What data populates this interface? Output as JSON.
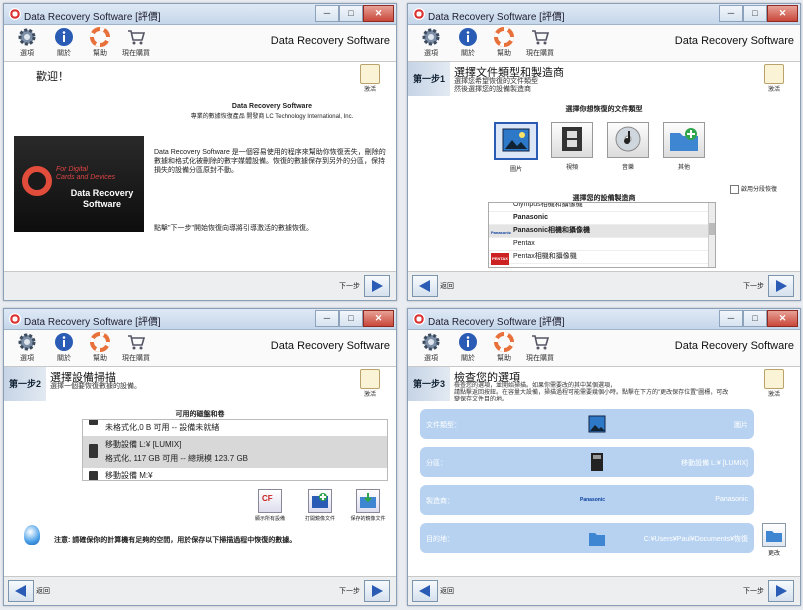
{
  "app": {
    "window_title": "Data Recovery Software [評價]",
    "brand": "Data Recovery Software",
    "toolbar": [
      "選項",
      "關於",
      "幫助",
      "現在購買"
    ],
    "key_label": "激活",
    "next_label": "下一步",
    "back_label": "返回",
    "win_controls": {
      "min": "─",
      "max": "□",
      "close": "✕"
    }
  },
  "colors": {
    "accent": "#2a5bb5",
    "summary_row": "#b7d2f0",
    "logo_red": "#e24c3b"
  },
  "icons": {
    "options": "gear-icon",
    "about": "info-icon",
    "help": "lifebuoy-icon",
    "buy": "cart-icon",
    "activate": "key-icon",
    "next": "arrow-right-icon",
    "back": "arrow-left-icon"
  },
  "w1": {
    "title": "歡迎！",
    "product": "Data Recovery Software",
    "company": "專業的數據恢復產品 開發商 LC Technology International, Inc.",
    "desc": "Data Recovery Software 是一個容易使用的程序來幫助你恢復丟失，刪除的數據和格式化被刪除的數字媒體設備。恢復的數據保存到另外的分區，保持損失的設備分區原封不動。",
    "hint": "點擊\"下一步\"開始恢復向導將引導激活的數據恢復。",
    "logo_red": "For Digital\nCards and Devices",
    "logo_white": "Data Recovery Software"
  },
  "w2": {
    "step": "第一步1",
    "title": "選擇文件類型和製造商",
    "sub": "選擇您希望恢復的文件類型\n然後選擇您的設備製造商",
    "file_types_header": "選擇你想恢復的文件類型",
    "file_types": [
      "圖片",
      "視頻",
      "音樂",
      "其他"
    ],
    "advanced_label": "啟用分段恢復",
    "mfr_header": "選擇您的設備製造商",
    "mfr_rows": [
      "Olympus相機和攝像機",
      "Panasonic",
      "Panasonic相機和攝像機",
      "Pentax",
      "Pentax相機和攝像機"
    ],
    "mfr_logo_panasonic": "Panasonic",
    "mfr_logo_pentax": "PENTAX"
  },
  "w3": {
    "step": "第一步2",
    "title": "選擇設備掃描",
    "sub": "選擇一個要恢復數據的設備。",
    "drives_header": "可用的磁盤和卷",
    "drives": [
      "未格式化,0 B 可用 -- 設備未就緒",
      "移動設備 L:¥ [LUMIX]",
      "格式化, 117 GB 可用 -- 總規模  123.7 GB",
      "移動設備 M:¥"
    ],
    "actions": [
      "顯示所有設備",
      "打開鏡像文件",
      "保存的鏡像文件"
    ],
    "cf_badge": "CF",
    "notice": "注意: 請確保你的計算機有足夠的空間，用於保存以下掃描過程中恢復的數據。"
  },
  "w4": {
    "step": "第一步3",
    "title": "檢查您的選項",
    "sub": "檢查您的選項，並開始掃描。如果你需要改的其中某個選項，\n請點擊返回按鈕。在容量大設備，掃描過程可能需要幾個小時。點擊在下方的\"更改保存位置\"圖標，可改\n變保存文件目的地。",
    "rows": [
      {
        "k": "文件類型：",
        "v": "圖片"
      },
      {
        "k": "分區：",
        "v": "移動設備 L:¥ [LUMIX]"
      },
      {
        "k": "製造商：",
        "v": "Panasonic"
      },
      {
        "k": "目的地：",
        "v": "C:¥Users¥Paul¥Documents¥恢復"
      }
    ],
    "mfr_logo": "Panasonic",
    "change_label": "更改"
  }
}
